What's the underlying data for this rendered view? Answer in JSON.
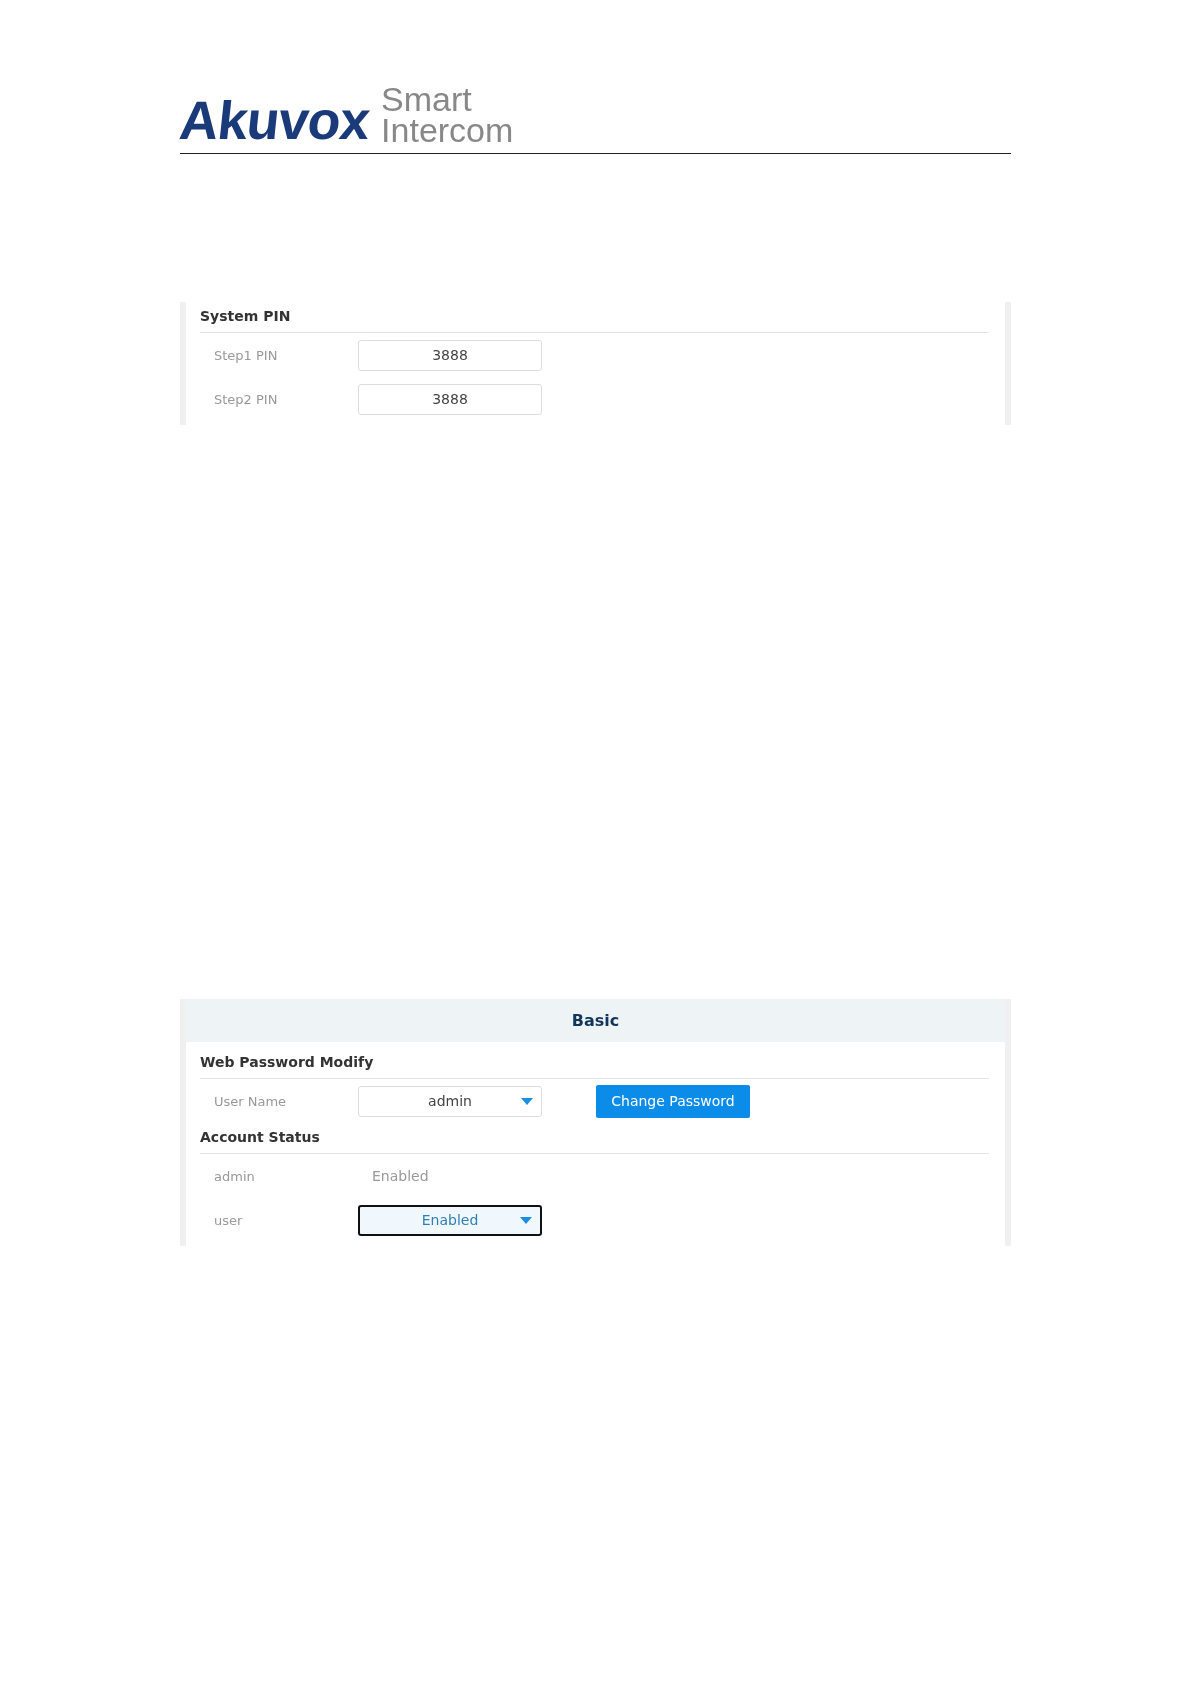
{
  "header": {
    "brand": "Akuvox",
    "tagline_top": "Smart",
    "tagline_bottom": "Intercom"
  },
  "system_pin": {
    "title": "System PIN",
    "rows": [
      {
        "label": "Step1 PIN",
        "value": "3888"
      },
      {
        "label": "Step2 PIN",
        "value": "3888"
      }
    ]
  },
  "basic": {
    "title": "Basic",
    "web_password": {
      "title": "Web Password Modify",
      "label": "User Name",
      "select": {
        "value": "admin",
        "focused": false
      },
      "button": "Change Password"
    },
    "account_status": {
      "title": "Account Status",
      "rows": [
        {
          "kind": "text",
          "label": "admin",
          "value": "Enabled"
        },
        {
          "kind": "select",
          "label": "user",
          "value": "Enabled",
          "focused": true
        }
      ]
    }
  }
}
